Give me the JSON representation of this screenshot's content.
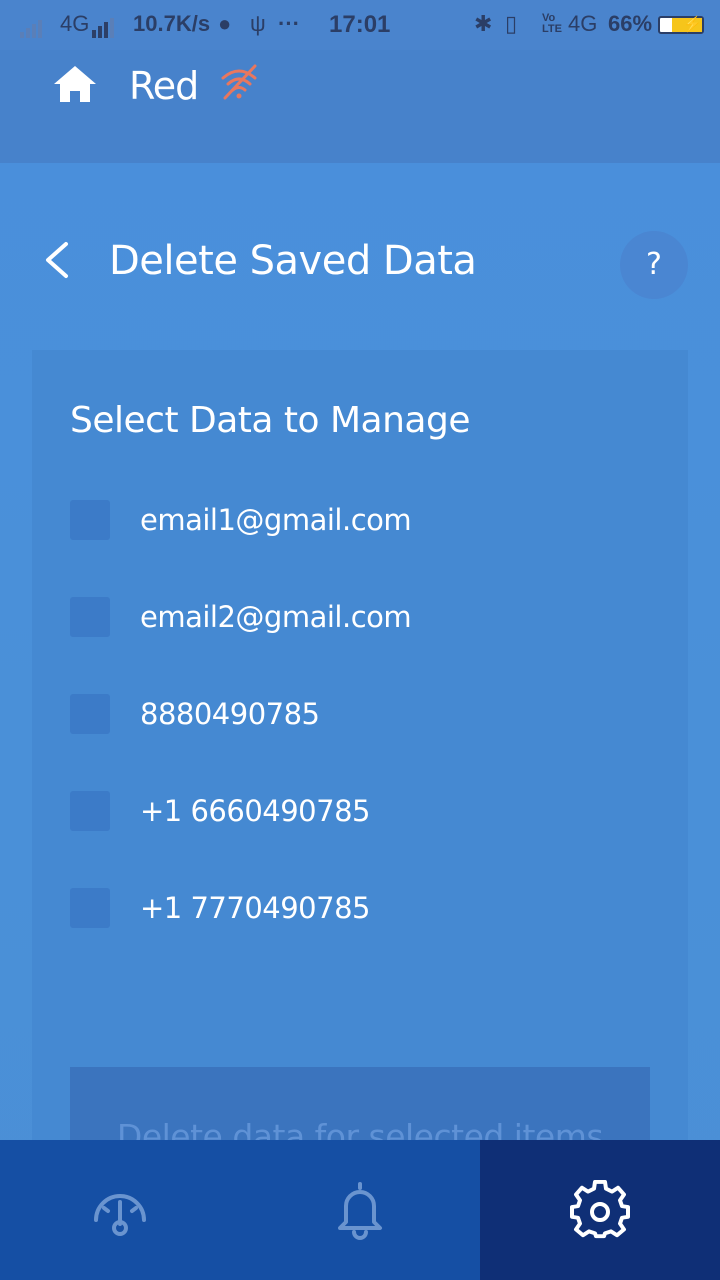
{
  "status_bar": {
    "network_left": "4G",
    "speed": "10.7K/s",
    "time": "17:01",
    "network_right": "4G",
    "volte": "Vo LTE",
    "battery": "66%"
  },
  "app": {
    "title": "Red"
  },
  "page": {
    "title": "Delete Saved Data",
    "help_label": "?"
  },
  "card": {
    "title": "Select Data to Manage",
    "options": [
      {
        "label": "email1@gmail.com",
        "checked": false
      },
      {
        "label": "email2@gmail.com",
        "checked": false
      },
      {
        "label": "8880490785",
        "checked": false
      },
      {
        "label": "+1 6660490785",
        "checked": false
      },
      {
        "label": "+1 7770490785",
        "checked": false
      }
    ],
    "delete_button_label": "Delete data for selected items"
  },
  "bottom_nav": {
    "items": [
      {
        "icon": "speedometer-icon",
        "active": false
      },
      {
        "icon": "bell-icon",
        "active": false
      },
      {
        "icon": "gear-icon",
        "active": true
      }
    ]
  },
  "colors": {
    "header": "#4782cb",
    "background": "#4a90d8",
    "card": "#4589d2",
    "nav": "#154fa4",
    "nav_active": "#0f2f76",
    "no_wifi_icon": "#e8775e"
  }
}
